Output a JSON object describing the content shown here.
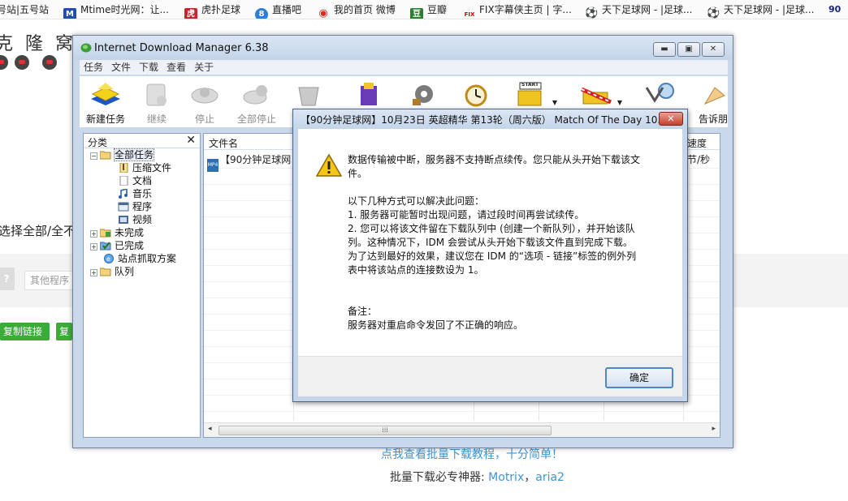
{
  "bookmarks": [
    {
      "label": "号站|五号站",
      "icon": "none"
    },
    {
      "label": "Mtime时光网：让...",
      "icon": "mtime-icon",
      "glyph": "M",
      "color": "#1f4fa8"
    },
    {
      "label": "虎扑足球",
      "icon": "hupu-icon",
      "glyph": "虎",
      "color": "#c8222b"
    },
    {
      "label": "直播吧",
      "icon": "zhibo8-icon",
      "glyph": "8",
      "color": "#2b7fd4"
    },
    {
      "label": "我的首页 微博",
      "icon": "weibo-icon",
      "glyph": "◉",
      "color": "#d52b1e"
    },
    {
      "label": "豆瓣",
      "icon": "douban-icon",
      "glyph": "豆",
      "color": "#2a7f2f"
    },
    {
      "label": "FIX字幕侠主页 | 字...",
      "icon": "fix-icon",
      "glyph": "FIX",
      "color": "#cc2222"
    },
    {
      "label": "天下足球网 - |足球...",
      "icon": "soccer-ball-icon",
      "glyph": "⚽",
      "color": "#333333"
    },
    {
      "label": "天下足球网 - |足球...",
      "icon": "soccer-ball-icon",
      "glyph": "⚽",
      "color": "#333333"
    },
    {
      "label": "90",
      "icon": "none"
    }
  ],
  "background_page": {
    "logo": "克 隆 窝",
    "select_text": "选择全部/全不",
    "other_program": "其他程序",
    "copy_link": "复制链接",
    "copy_partial": "复",
    "tutorial_link": "点我查看批量下载教程，十分简单！",
    "tools_prefix": "批量下载必专神器: ",
    "tool1": "Motrix",
    "tool_sep": "，",
    "tool2": "aria2"
  },
  "idm": {
    "title": "Internet Download Manager 6.38",
    "window_buttons": {
      "minimize": "▬",
      "maximize": "▣",
      "close": "✕"
    },
    "menu": [
      "任务",
      "文件",
      "下载",
      "查看",
      "关于"
    ],
    "toolbar": [
      {
        "label": "新建任务",
        "icon": "new-task-icon",
        "disabled": false
      },
      {
        "label": "继续",
        "icon": "resume-icon",
        "disabled": true
      },
      {
        "label": "停止",
        "icon": "stop-icon",
        "disabled": true
      },
      {
        "label": "全部停止",
        "icon": "stop-all-icon",
        "disabled": true
      },
      {
        "label": "",
        "icon": "delete-icon",
        "disabled": true
      },
      {
        "label": "",
        "icon": "delete-completed-icon",
        "disabled": false
      },
      {
        "label": "",
        "icon": "options-gear-icon",
        "disabled": false
      },
      {
        "label": "",
        "icon": "scheduler-clock-icon",
        "disabled": false
      },
      {
        "label": "",
        "icon": "start-queue-icon",
        "disabled": false
      },
      {
        "label": "",
        "icon": "stop-queue-icon",
        "disabled": false
      },
      {
        "label": "",
        "icon": "grabber-icon",
        "disabled": false
      },
      {
        "label": "告诉朋",
        "icon": "tell-friend-icon",
        "disabled": false
      }
    ],
    "start_flag": "START",
    "tree": {
      "header": "分类",
      "close": "✕",
      "nodes": [
        {
          "label": "全部任务",
          "expander": "−",
          "icon": "folder-open-icon",
          "selected": true
        },
        {
          "label": "压缩文件",
          "icon": "zip-icon"
        },
        {
          "label": "文档",
          "icon": "document-icon"
        },
        {
          "label": "音乐",
          "icon": "music-icon"
        },
        {
          "label": "程序",
          "icon": "program-icon"
        },
        {
          "label": "视频",
          "icon": "video-icon"
        },
        {
          "label": "未完成",
          "expander": "+",
          "icon": "unfinished-icon"
        },
        {
          "label": "已完成",
          "expander": "+",
          "icon": "finished-icon"
        },
        {
          "label": "站点抓取方案",
          "icon": "site-grabber-icon"
        },
        {
          "label": "队列",
          "expander": "+",
          "icon": "queue-icon"
        }
      ]
    },
    "list": {
      "columns": [
        "文件名",
        "速度"
      ],
      "speed_partial": "节/秒",
      "row_name": "【90分钟足球网",
      "file_badge": "MP4",
      "scroll_left": "◂",
      "scroll_right": "▸",
      "scroll_grip": "⁞⁞⁞"
    }
  },
  "dialog": {
    "title": "【90分钟足球网】10月23日 英超精华 第13轮（周六版） Match Of The Day 10...",
    "close": "✕",
    "message_lines": [
      "数据传输被中断，服务器不支持断点续传。您只能从头开始下载该文",
      "件。",
      "以下几种方式可以解决此问题：",
      " 1. 服务器可能暂时出现问题，请过段时间再尝试续传。",
      " 2. 您可以将该文件留在下载队列中 (创建一个新队列），并开始该队",
      "列。这种情况下，IDM 会尝试从头开始下载该文件直到完成下载。",
      " 为了达到最好的效果，建议您在 IDM 的“选项 - 链接”标签的例外列",
      "表中将该站点的连接数设为 1。",
      "备注：",
      "服务器对重启命令发回了不正确的响应。"
    ],
    "ok_label": "确定"
  }
}
